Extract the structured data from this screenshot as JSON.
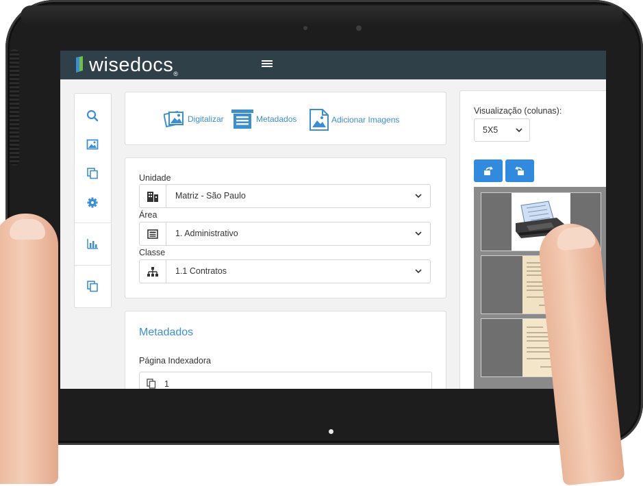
{
  "app": {
    "logo_text": "wisedocs",
    "logo_mark": "®"
  },
  "sidebar": {
    "icons": [
      "search-icon",
      "image-icon",
      "copy-icon",
      "gear-icon",
      "bar-chart-icon",
      "copy-icon"
    ]
  },
  "actions": [
    {
      "label": "Digitalizar",
      "icon": "images-stack-icon"
    },
    {
      "label": "Metadados",
      "icon": "list-document-icon"
    },
    {
      "label": "Adicionar Imagens",
      "icon": "add-image-icon"
    }
  ],
  "filters": {
    "unidade": {
      "label": "Unidade",
      "value": "Matriz - São Paulo",
      "icon": "building-icon"
    },
    "area": {
      "label": "Área",
      "value": "1. Administrativo",
      "icon": "newspaper-icon"
    },
    "classe": {
      "label": "Classe",
      "value": "1.1 Contratos",
      "icon": "sitemap-icon"
    }
  },
  "metadados": {
    "title": "Metadados",
    "pagina_label": "Página Indexadora",
    "pagina_value": "1"
  },
  "viewer": {
    "columns_label": "Visualização (colunas):",
    "columns_value": "5X5"
  },
  "colors": {
    "accent": "#3a8fd1",
    "topbar": "#304048",
    "button": "#2f8ae0"
  }
}
